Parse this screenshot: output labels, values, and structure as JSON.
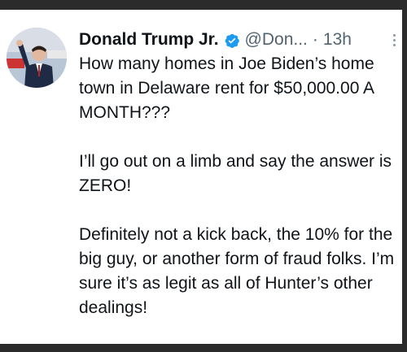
{
  "tweet": {
    "author_name": "Donald Trump Jr.",
    "handle": "@Don...",
    "separator": "·",
    "time": "13h",
    "verified_icon": "verified-badge-icon",
    "more_icon": "more-vertical-icon",
    "paragraphs": [
      "How many homes in Joe Biden’s home town in Delaware rent for $50,000.00 A MONTH???",
      "I’ll go out on a limb and say the answer is ZERO!",
      "Definitely not a kick back, the 10% for the big guy, or another form of fraud folks. I’m sure it’s as legit as all of Hunter’s other dealings!"
    ]
  },
  "colors": {
    "text": "#0f1419",
    "muted": "#536471",
    "verified": "#1d9bf0",
    "frame": "#2b2b2b"
  }
}
